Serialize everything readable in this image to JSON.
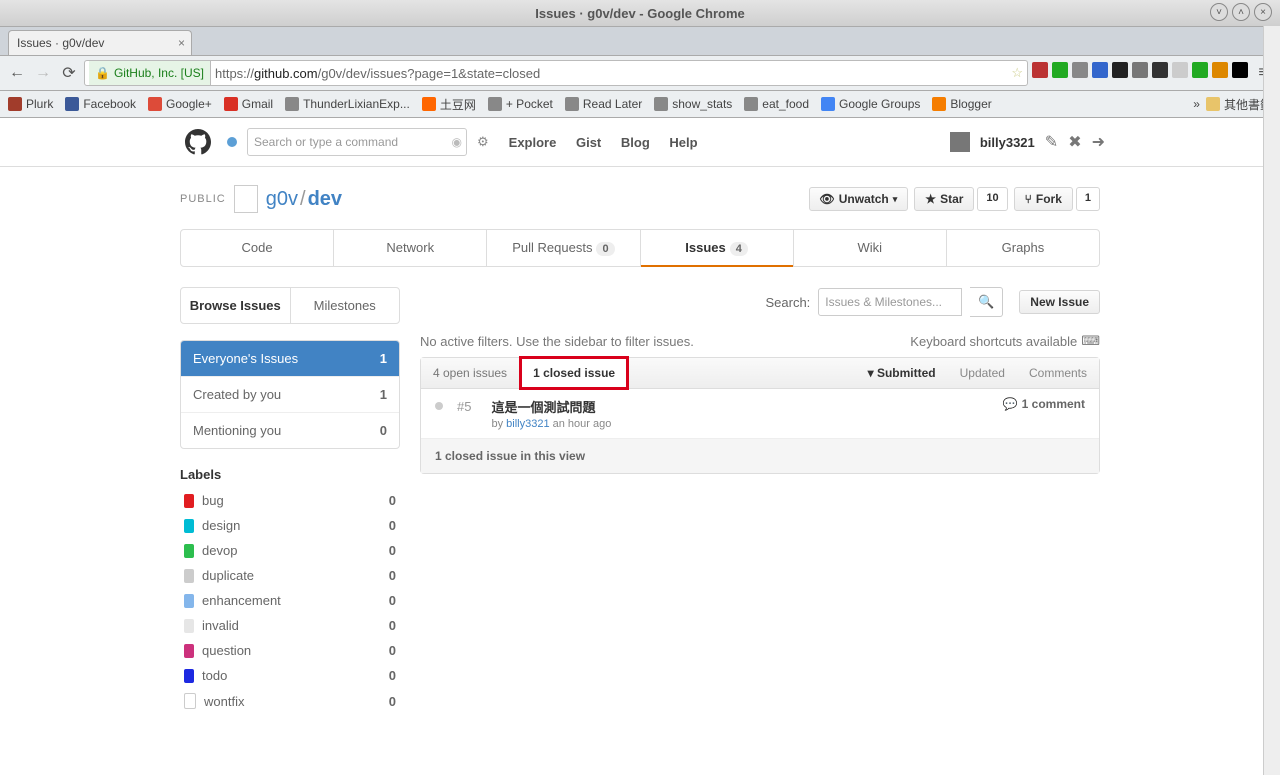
{
  "os_title": "Issues  ·   g0v/dev - Google Chrome",
  "tab_title": "Issues ·  g0v/dev",
  "ssl_label": "GitHub, Inc. [US]",
  "url_scheme": "https://",
  "url_domain": "github.com",
  "url_path": "/g0v/dev/issues?page=1&state=closed",
  "bookmarks": [
    {
      "label": "Plurk",
      "color": "#a13c2b"
    },
    {
      "label": "Facebook",
      "color": "#3b5998"
    },
    {
      "label": "Google+",
      "color": "#dd4b39"
    },
    {
      "label": "Gmail",
      "color": "#d93025"
    },
    {
      "label": "ThunderLixianExp...",
      "color": "#888"
    },
    {
      "label": "土豆网",
      "color": "#f60"
    },
    {
      "label": "+ Pocket",
      "color": "#888"
    },
    {
      "label": "Read Later",
      "color": "#888"
    },
    {
      "label": "show_stats",
      "color": "#888"
    },
    {
      "label": "eat_food",
      "color": "#888"
    },
    {
      "label": "Google Groups",
      "color": "#4285f4"
    },
    {
      "label": "Blogger",
      "color": "#f57d00"
    }
  ],
  "bookmarks_overflow": "»",
  "bookmarks_folder": "其他書籤",
  "gh": {
    "search_placeholder": "Search or type a command",
    "nav": [
      "Explore",
      "Gist",
      "Blog",
      "Help"
    ],
    "username": "billy3321"
  },
  "repo": {
    "visibility": "PUBLIC",
    "owner": "g0v",
    "name": "dev",
    "actions": {
      "watch": "Unwatch",
      "star": "Star",
      "star_count": "10",
      "fork": "Fork",
      "fork_count": "1"
    },
    "tabs": [
      {
        "label": "Code"
      },
      {
        "label": "Network"
      },
      {
        "label": "Pull Requests",
        "count": "0"
      },
      {
        "label": "Issues",
        "count": "4",
        "active": true
      },
      {
        "label": "Wiki"
      },
      {
        "label": "Graphs"
      }
    ]
  },
  "issues": {
    "subnav": {
      "browse": "Browse Issues",
      "milestones": "Milestones"
    },
    "searchlabel": "Search:",
    "search_placeholder": "Issues & Milestones...",
    "newissue": "New Issue",
    "nofilter": "No active filters. Use the sidebar to filter issues.",
    "shortcuts": "Keyboard shortcuts available",
    "filters": [
      {
        "label": "Everyone's Issues",
        "count": "1",
        "selected": true
      },
      {
        "label": "Created by you",
        "count": "1"
      },
      {
        "label": "Mentioning you",
        "count": "0"
      }
    ],
    "labels_header": "Labels",
    "labels": [
      {
        "name": "bug",
        "color": "#e11d21",
        "count": "0"
      },
      {
        "name": "design",
        "color": "#00bcd4",
        "count": "0"
      },
      {
        "name": "devop",
        "color": "#2cbe4e",
        "count": "0"
      },
      {
        "name": "duplicate",
        "color": "#cccccc",
        "count": "0"
      },
      {
        "name": "enhancement",
        "color": "#84b6eb",
        "count": "0"
      },
      {
        "name": "invalid",
        "color": "#e6e6e6",
        "count": "0"
      },
      {
        "name": "question",
        "color": "#cc317c",
        "count": "0"
      },
      {
        "name": "todo",
        "color": "#1d29e1",
        "count": "0"
      },
      {
        "name": "wontfix",
        "color": "#ffffff",
        "count": "0"
      }
    ],
    "states": {
      "open": "4 open issues",
      "closed": "1 closed issue"
    },
    "sorts": {
      "submitted": "Submitted",
      "updated": "Updated",
      "comments": "Comments"
    },
    "row": {
      "num": "#5",
      "title": "這是一個測試問題",
      "by": "by ",
      "author": "billy3321",
      "time": " an hour ago",
      "comments": "1 comment"
    },
    "footer": "1 closed issue in this view"
  }
}
